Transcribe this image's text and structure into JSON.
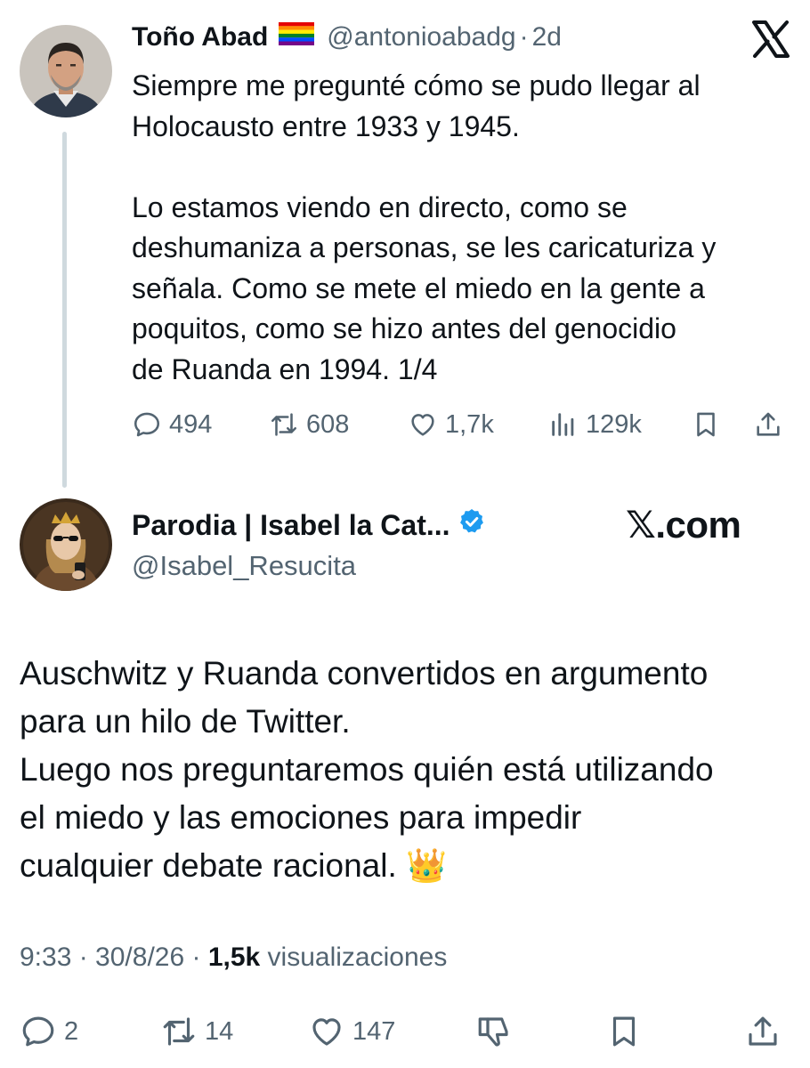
{
  "tweet1": {
    "author_name": "Toño Abad",
    "flag_icon": "rainbow-flag-icon",
    "handle": "@antonioabadg",
    "separator": "·",
    "time": "2d",
    "text": "Siempre me pregunté cómo se pudo llegar al\nHolocausto entre 1933 y 1945.\n\nLo estamos viendo en directo, como se\ndeshumaniza a personas, se les caricaturiza y\nseñala. Como se mete el miedo en la gente a\npoquitos, como se hizo antes del genocidio\nde Ruanda en 1994. 1/4",
    "stats": {
      "replies": "494",
      "reposts": "608",
      "likes": "1,7k",
      "views": "129k"
    }
  },
  "tweet2": {
    "author_name": "Parodia | Isabel la Cat...",
    "verified_icon": "verified-badge-icon",
    "handle": "@Isabel_Resucita",
    "watermark": "𝕏.com",
    "text": "Auschwitz y Ruanda convertidos en argumento\npara un hilo de Twitter.\nLuego nos preguntaremos quién está utilizando\nel miedo y las emociones para impedir\ncualquier debate racional. 👑",
    "timestamp": "9:33 · 30/8/26 ·",
    "views_count": "1,5k",
    "views_label": "visualizaciones",
    "stats": {
      "replies": "2",
      "reposts": "14",
      "likes": "147"
    }
  },
  "colors": {
    "text": "#0f1419",
    "secondary": "#536471",
    "verified": "#1d9bf0",
    "thread_line": "#cfd9de"
  }
}
